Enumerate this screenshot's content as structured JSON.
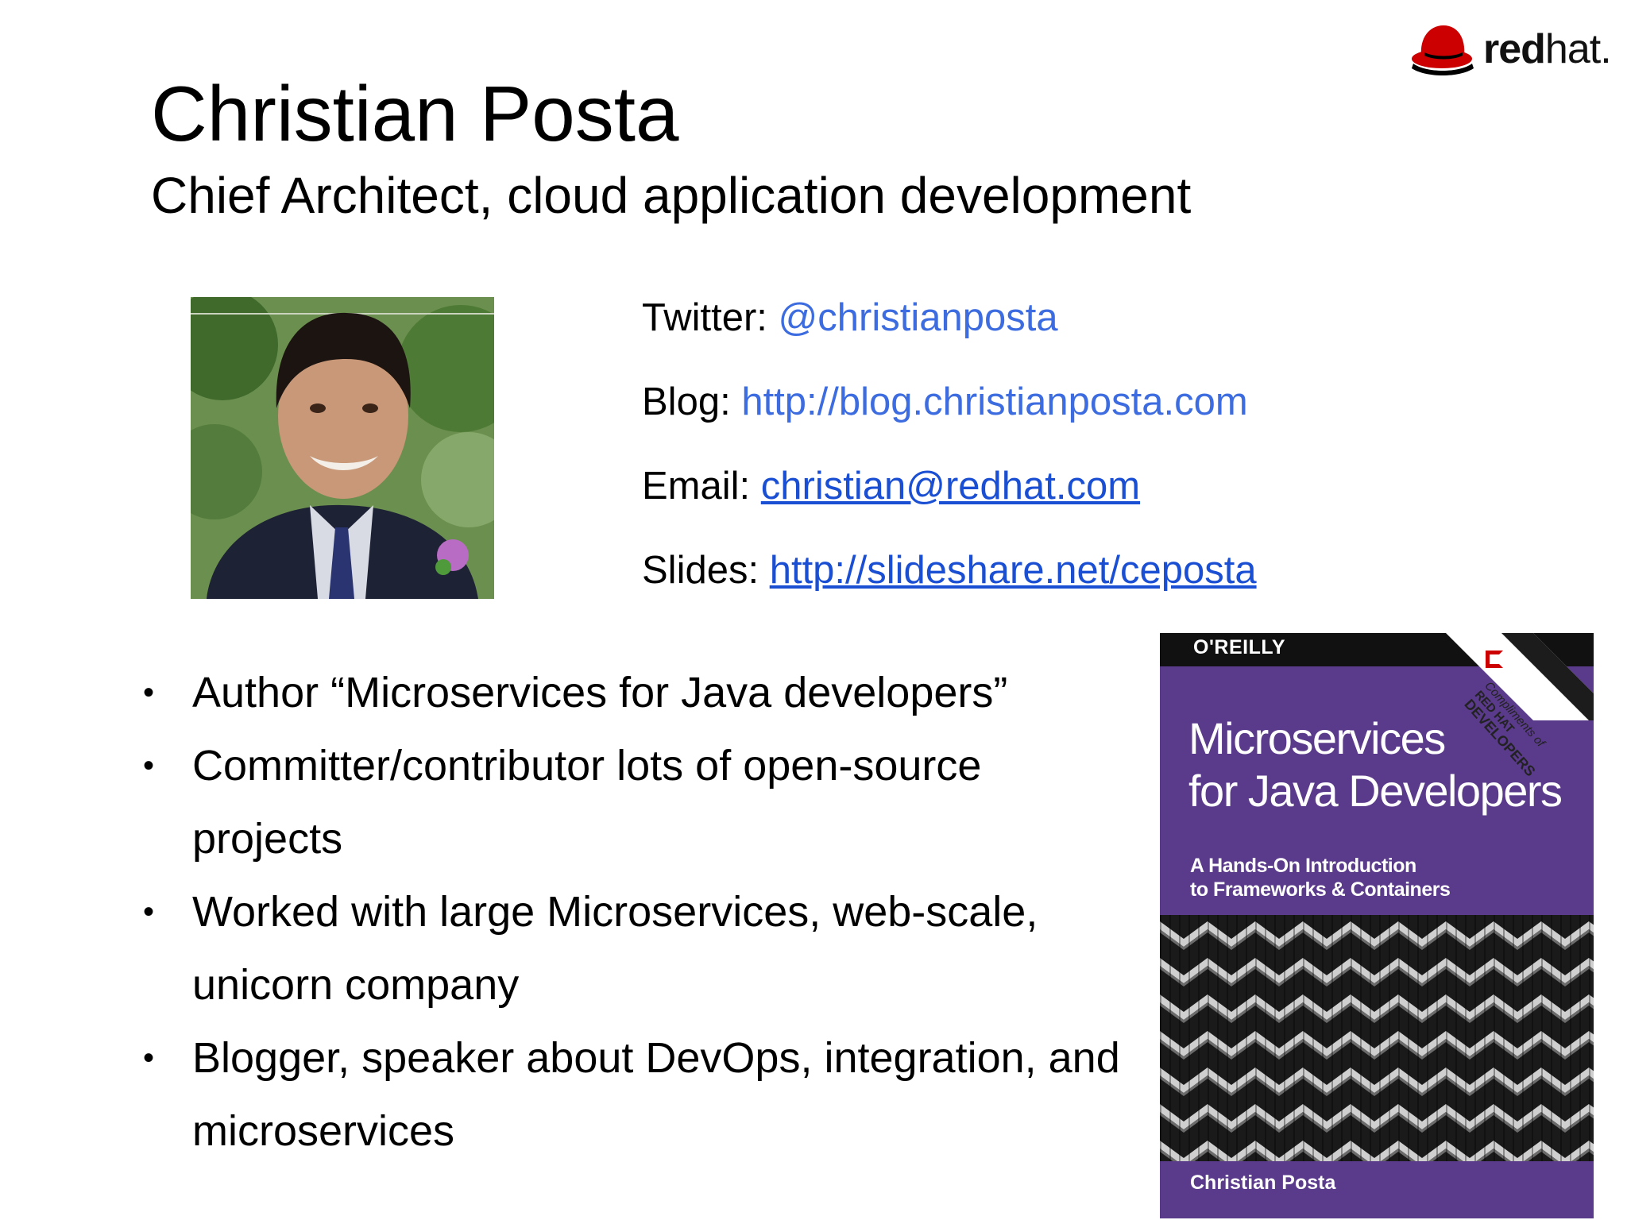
{
  "brand": {
    "logo_red": "red",
    "logo_hat": "hat",
    "logo_dot": ".",
    "icon": "redhat-shadowman-icon"
  },
  "header": {
    "title": "Christian Posta",
    "subtitle": "Chief Architect, cloud application development"
  },
  "contacts": [
    {
      "label": "Twitter:",
      "value": "@christianposta"
    },
    {
      "label": "Blog:",
      "value": "http://blog.christianposta.com"
    },
    {
      "label": "Email:",
      "value": "christian@redhat.com"
    },
    {
      "label": "Slides:",
      "value": "http://slideshare.net/ceposta"
    }
  ],
  "bullets": [
    "Author “Microservices for Java developers”",
    "Committer/contributor lots of open-source projects",
    "Worked with large Microservices, web-scale, unicorn company",
    "Blogger, speaker about DevOps, integration, and microservices"
  ],
  "book": {
    "publisher": "O'REILLY",
    "title_line1": "Microservices",
    "title_line2": "for Java Developers",
    "subtitle_line1": "A Hands-On Introduction",
    "subtitle_line2": "to Frameworks & Containers",
    "author": "Christian Posta",
    "ribbon_line1": "Compliments of",
    "ribbon_line2": "RED HAT",
    "ribbon_line3": "DEVELOPERS"
  },
  "colors": {
    "link": "#3c6ce0",
    "book_purple": "#5a3a8a",
    "redhat_red": "#cc0000"
  }
}
